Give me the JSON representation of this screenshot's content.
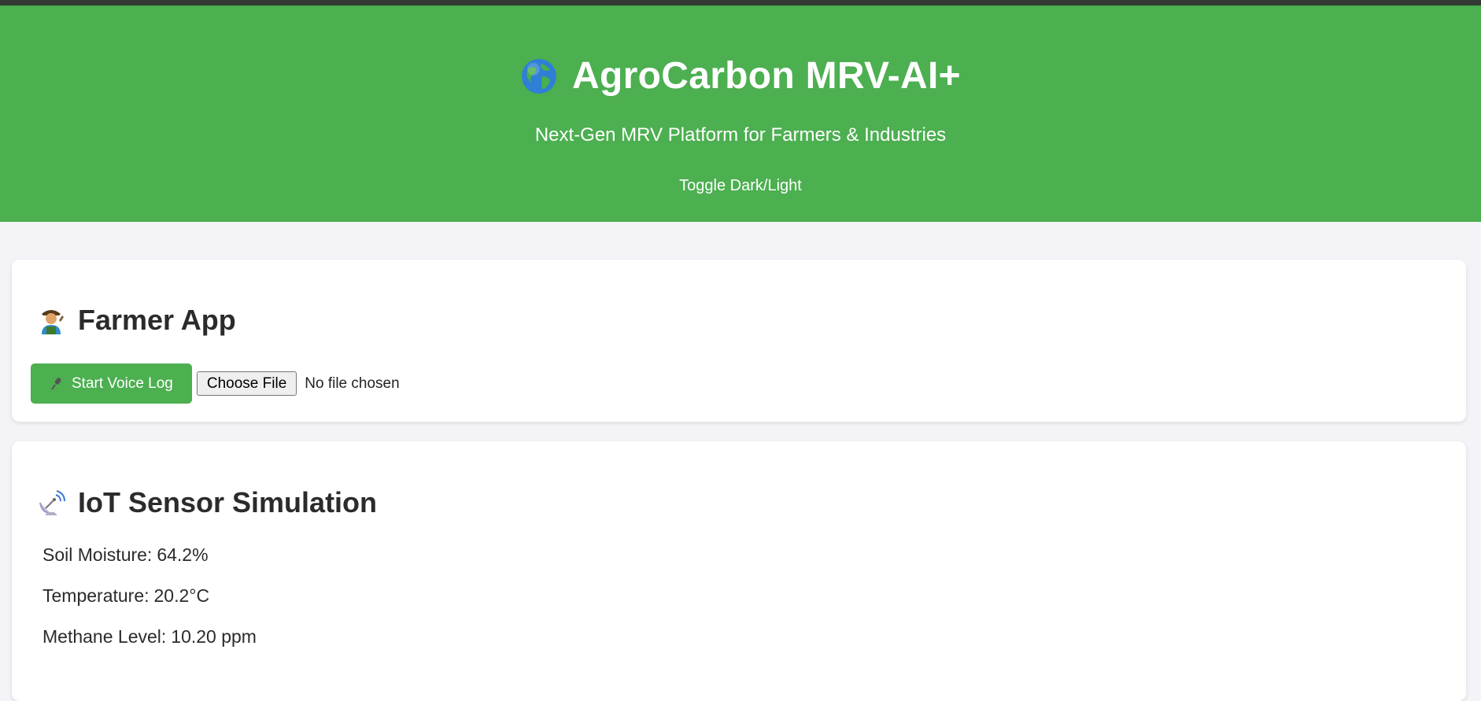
{
  "header": {
    "globe_icon": "globe-icon",
    "title": "AgroCarbon MRV-AI+",
    "subtitle": "Next-Gen MRV Platform for Farmers & Industries",
    "toggle_label": "Toggle Dark/Light",
    "background_color": "#4caf50"
  },
  "farmer_app": {
    "icon": "farmer-icon",
    "title": "Farmer App",
    "voice_button_icon": "microphone-icon",
    "voice_button_label": "Start Voice Log",
    "file_button_label": "Choose File",
    "file_status": "No file chosen"
  },
  "iot": {
    "icon": "satellite-dish-icon",
    "title": "IoT Sensor Simulation",
    "sensors": [
      {
        "label": "Soil Moisture:",
        "value": "64.2%"
      },
      {
        "label": "Temperature:",
        "value": "20.2°C"
      },
      {
        "label": "Methane Level:",
        "value": "10.20 ppm"
      }
    ]
  }
}
